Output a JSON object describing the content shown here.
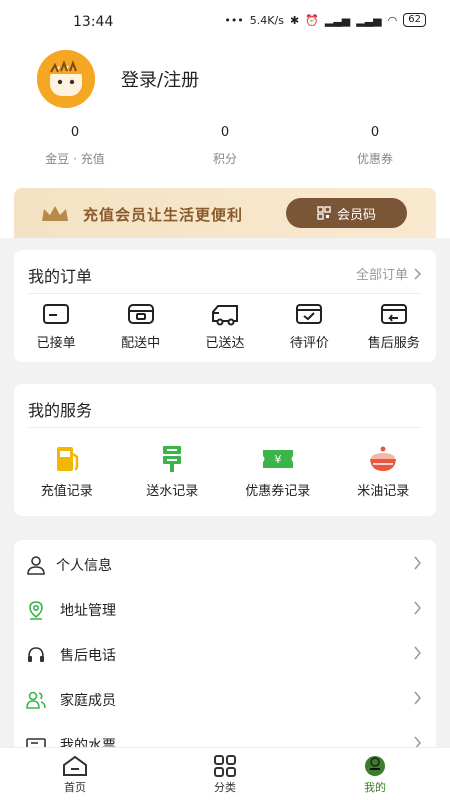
{
  "status_bar": {
    "time": "13:44",
    "network": "5.4K/s",
    "battery": "62"
  },
  "profile": {
    "login_label": "登录/注册"
  },
  "stats": [
    {
      "value": "0",
      "label": "金豆 · 充值"
    },
    {
      "value": "0",
      "label": "积分"
    },
    {
      "value": "0",
      "label": "优惠券"
    }
  ],
  "member": {
    "text": "充值会员让生活更便利",
    "button": "会员码"
  },
  "orders": {
    "title": "我的订单",
    "more": "全部订单",
    "items": [
      {
        "label": "已接单",
        "icon": "card-icon"
      },
      {
        "label": "配送中",
        "icon": "box-icon"
      },
      {
        "label": "已送达",
        "icon": "truck-icon"
      },
      {
        "label": "待评价",
        "icon": "review-icon"
      },
      {
        "label": "售后服务",
        "icon": "return-icon"
      }
    ]
  },
  "services": {
    "title": "我的服务",
    "items": [
      {
        "label": "充值记录",
        "icon": "fuel-icon"
      },
      {
        "label": "送水记录",
        "icon": "water-icon"
      },
      {
        "label": "优惠券记录",
        "icon": "coupon-icon"
      },
      {
        "label": "米油记录",
        "icon": "rice-bowl-icon"
      }
    ]
  },
  "menu": [
    {
      "label": "个人信息",
      "icon": "person-icon"
    },
    {
      "label": "地址管理",
      "icon": "location-icon"
    },
    {
      "label": "售后电话",
      "icon": "headset-icon"
    },
    {
      "label": "家庭成员",
      "icon": "family-icon"
    },
    {
      "label": "我的水票",
      "icon": "ticket-icon"
    }
  ],
  "tabs": [
    {
      "label": "首页",
      "icon": "home-icon"
    },
    {
      "label": "分类",
      "icon": "grid-icon"
    },
    {
      "label": "我的",
      "icon": "profile-icon"
    }
  ],
  "colors": {
    "accent_green": "#3a7d2c",
    "member_brown": "#7a5536",
    "avatar_orange": "#f5a623",
    "service_yellow": "#f2b705",
    "service_green": "#3bb54a",
    "service_red": "#e9573f"
  }
}
